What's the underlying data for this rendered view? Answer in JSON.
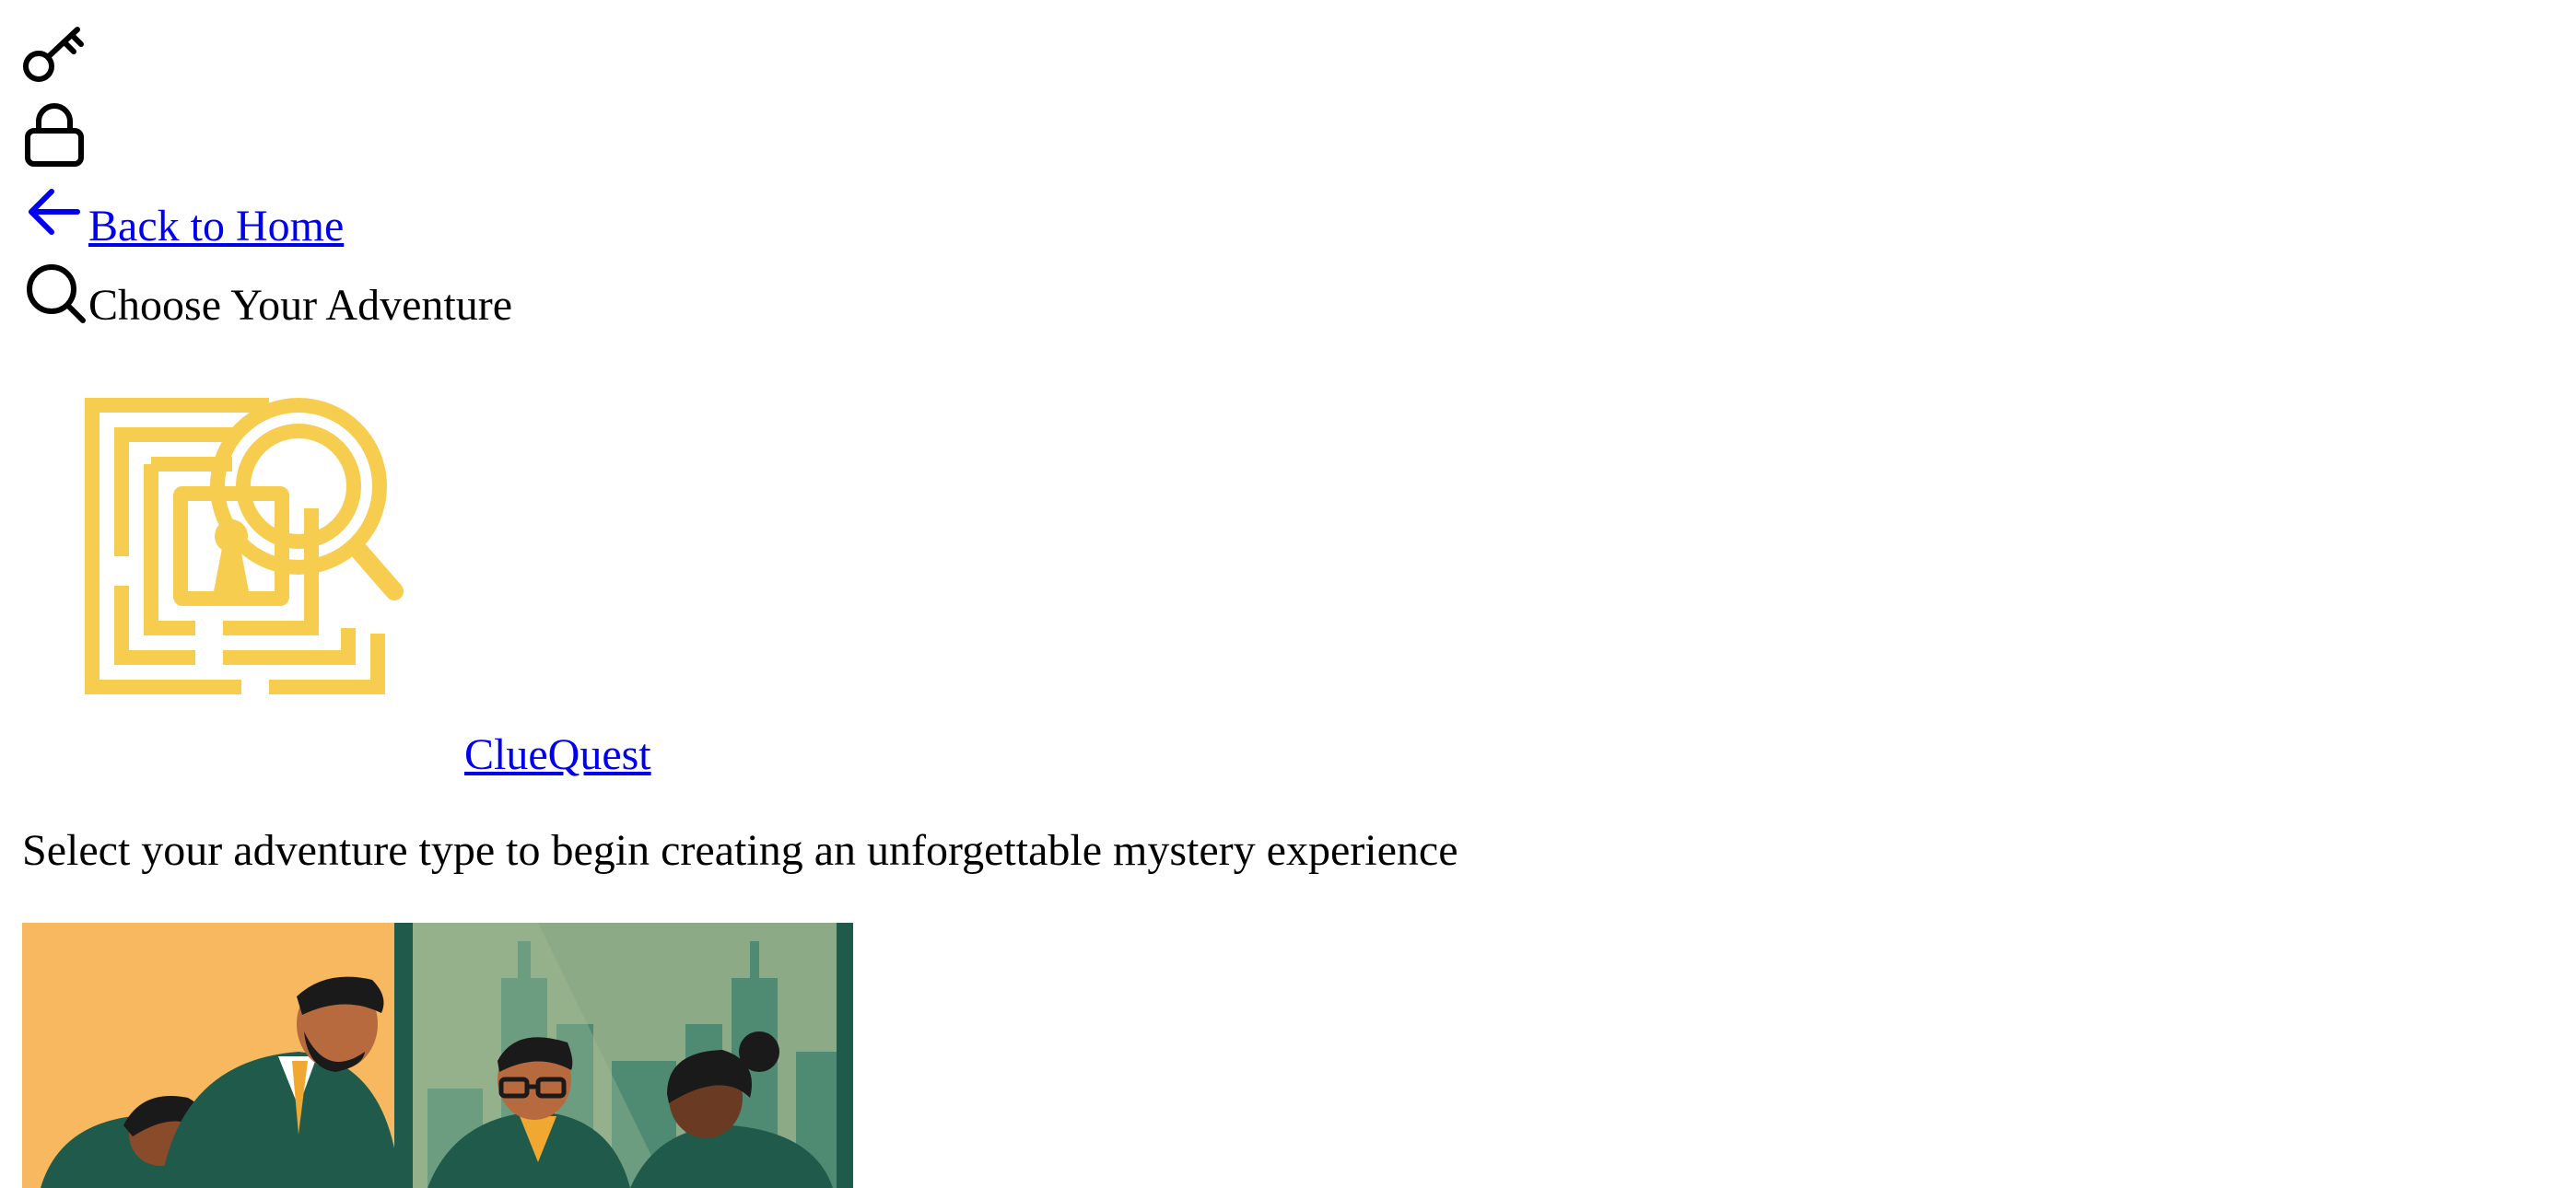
{
  "nav": {
    "back_label": "Back to Home",
    "choose_label": "Choose Your Adventure"
  },
  "brand": {
    "name": "ClueQuest",
    "logo_color": "#f7cd4f"
  },
  "tagline": "Select your adventure type to begin creating an unforgettable mystery experience",
  "icons": {
    "key": "key-icon",
    "lock": "lock-icon",
    "back": "arrow-left-icon",
    "search": "search-icon"
  },
  "colors": {
    "link": "#0000ee",
    "text": "#000000",
    "illustration_bg": "#f8b354",
    "illustration_window": "#8caa86",
    "illustration_suit": "#1f5a4a"
  }
}
